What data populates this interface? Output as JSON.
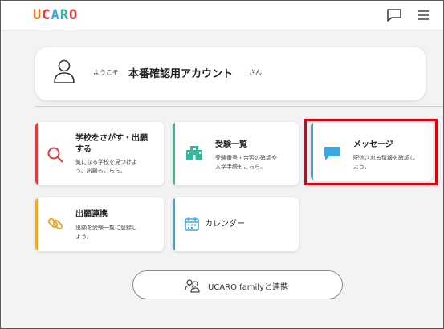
{
  "header": {
    "logo_letters": [
      "U",
      "C",
      "A",
      "R",
      "O"
    ],
    "logo_colors": [
      "#f07a24",
      "#e8383d",
      "#3aa8e0",
      "#34b79a",
      "#e8383d"
    ],
    "icons": [
      "chat-icon",
      "menu-icon"
    ]
  },
  "welcome": {
    "prefix": "ようこそ",
    "account_name": "本番確認用アカウント",
    "suffix": "さん",
    "icon": "user-icon"
  },
  "cards": [
    {
      "title_line1": "学校をさがす・出願",
      "title_line2": "する",
      "desc_line1": "気になる学校を見つけよ",
      "desc_line2": "う。出願もこちら。",
      "icon": "search-icon",
      "accent": "#e8383d"
    },
    {
      "title_line1": "受験一覧",
      "desc_line1": "受験番号・合否の確認や",
      "desc_line2": "入学手続もこちら。",
      "icon": "school-icon",
      "accent": "#34b79a"
    },
    {
      "title_line1": "メッセージ",
      "desc_line1": "配信される情報を確認し",
      "desc_line2": "よう。",
      "icon": "message-icon",
      "accent": "#3aa8e0"
    },
    {
      "title_line1": "出願連携",
      "desc_line1": "出願を受験一覧に登録し",
      "desc_line2": "よう。",
      "icon": "link-icon",
      "accent": "#f5a623"
    },
    {
      "title_line1": "カレンダー",
      "icon": "calendar-icon",
      "accent": "#3aa8e0"
    }
  ],
  "family_button": {
    "label": "UCARO familyと連携",
    "icon": "users-icon"
  },
  "highlight_color": "#e0000b"
}
